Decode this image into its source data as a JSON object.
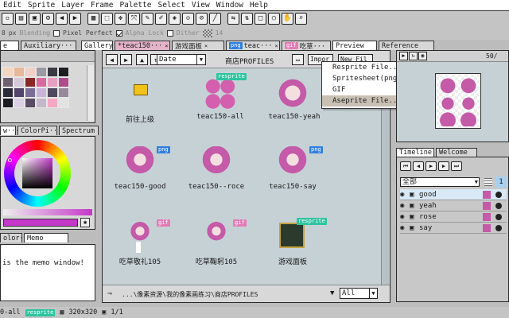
{
  "menu": [
    "Edit",
    "Sprite",
    "Layer",
    "Frame",
    "Palette",
    "Select",
    "View",
    "Window",
    "Help"
  ],
  "context_bar": {
    "brush_size": "8",
    "brush_unit": "px",
    "blending_label": "Blending",
    "pixel_perfect_label": "Pixel Perfect",
    "alpha_lock_label": "Alpha Lock",
    "dither_label": "Dither",
    "dither_value": "14"
  },
  "doc_tabs": [
    {
      "label": "e",
      "active": true
    },
    {
      "label": "Auxiliary···",
      "active": false
    },
    {
      "label": "Gallery",
      "active": true
    },
    {
      "label": "*teac150···",
      "active": false
    },
    {
      "label": "游戏面板",
      "active": false
    },
    {
      "label": "teac···",
      "badge": "png",
      "active": false
    },
    {
      "label": "吃草···",
      "badge": "gif",
      "active": false
    },
    {
      "label": "Preview",
      "active": true
    },
    {
      "label": "Reference",
      "active": false
    }
  ],
  "color_tabs": [
    "w···",
    "ColorPi···",
    "Spectrum"
  ],
  "memo_tabs": [
    "olor···",
    "Memo"
  ],
  "memo_text": "is the memo window!",
  "gallery": {
    "sort_value": "Date",
    "location_label": "商店PROFILES",
    "import_label": "Impor",
    "new_label": "New Fil",
    "items": [
      {
        "label": "前往上级",
        "type": "folder",
        "badge": ""
      },
      {
        "label": "teac150-all",
        "type": "sprite",
        "badge": "resprite"
      },
      {
        "label": "teac150-yeah",
        "type": "sprite",
        "badge": ""
      },
      {
        "label": "teac150-good",
        "type": "sprite",
        "badge": "png"
      },
      {
        "label": "teac150--roce",
        "type": "sprite",
        "badge": ""
      },
      {
        "label": "teac150-say",
        "type": "sprite",
        "badge": "png"
      },
      {
        "label": "吃草敬礼105",
        "type": "sprite",
        "badge": "gif"
      },
      {
        "label": "吃草鞠躬105",
        "type": "sprite",
        "badge": "gif"
      },
      {
        "label": "游戏面板",
        "type": "panel",
        "badge": "resprite"
      }
    ],
    "path": "...\\像素资源\\我的像素画练习\\商店PROFILES",
    "filter_value": "All"
  },
  "context_menu": {
    "items": [
      {
        "label": "Resprite File...",
        "submenu": false,
        "highlight": false
      },
      {
        "label": "Spritesheet(png)",
        "submenu": true,
        "highlight": false
      },
      {
        "label": "GIF",
        "submenu": true,
        "highlight": false
      },
      {
        "label": "Aseprite File...",
        "submenu": false,
        "highlight": true
      }
    ]
  },
  "preview": {
    "zoom": "50/"
  },
  "timeline": {
    "tabs": [
      "Timeline",
      "Welcome"
    ],
    "group": "全部",
    "frame_number": "1",
    "layers": [
      "good",
      "yeah",
      "rose",
      "say"
    ]
  },
  "status": {
    "file": "0-all",
    "badge": "resprite",
    "size": "320x320",
    "frame": "1/1"
  },
  "colors": {
    "accent_resprite": "#2ec4a0",
    "accent_png": "#2f7fe0",
    "accent_gif": "#e57ab6",
    "hair": "#c45aa8"
  }
}
